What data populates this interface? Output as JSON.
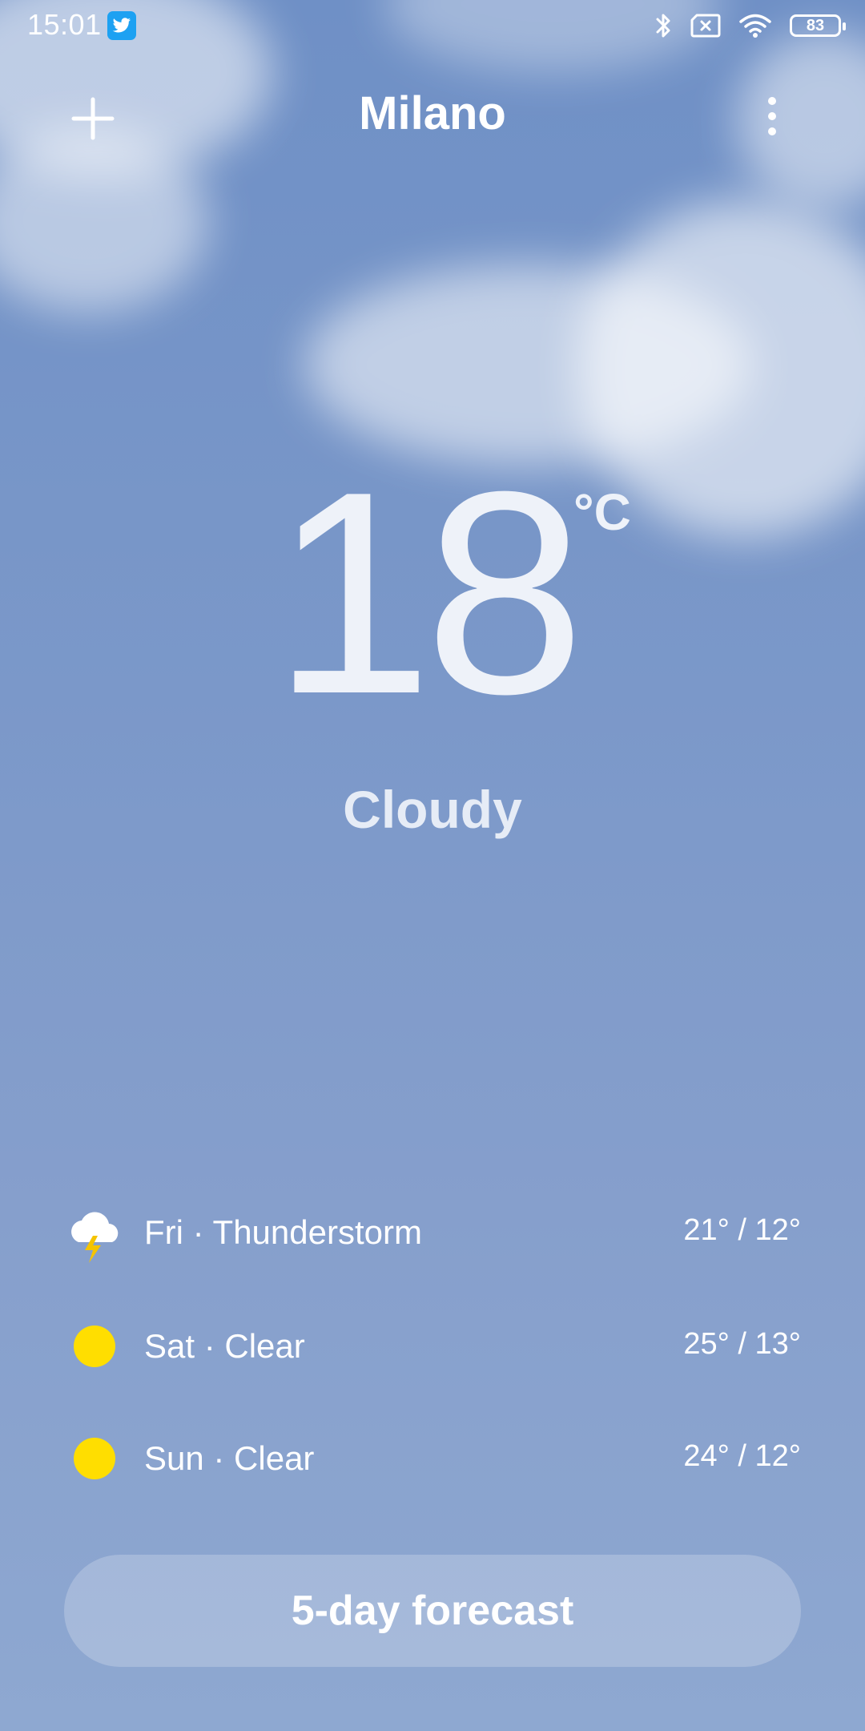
{
  "status_bar": {
    "time": "15:01",
    "battery": "83",
    "notification_icon": "twitter-icon",
    "icons": [
      "bluetooth-icon",
      "no-sim-icon",
      "wifi-icon",
      "battery-icon"
    ]
  },
  "header": {
    "city": "Milano",
    "add_icon": "plus-icon",
    "more_icon": "more-vertical-icon"
  },
  "current": {
    "temperature": "18",
    "unit": "°C",
    "condition": "Cloudy"
  },
  "forecast": [
    {
      "label": "Fri · Thunderstorm",
      "temps": "21° / 12°",
      "icon": "thunderstorm-icon"
    },
    {
      "label": "Sat · Clear",
      "temps": "25° / 13°",
      "icon": "sun-icon"
    },
    {
      "label": "Sun · Clear",
      "temps": "24° / 12°",
      "icon": "sun-icon"
    }
  ],
  "forecast_button_label": "5-day forecast",
  "colors": {
    "sky_top": "#6f90c6",
    "sky_bottom": "#8ea8d1",
    "sun": "#ffde00",
    "lightning": "#f5c400",
    "twitter": "#1da1f2"
  }
}
